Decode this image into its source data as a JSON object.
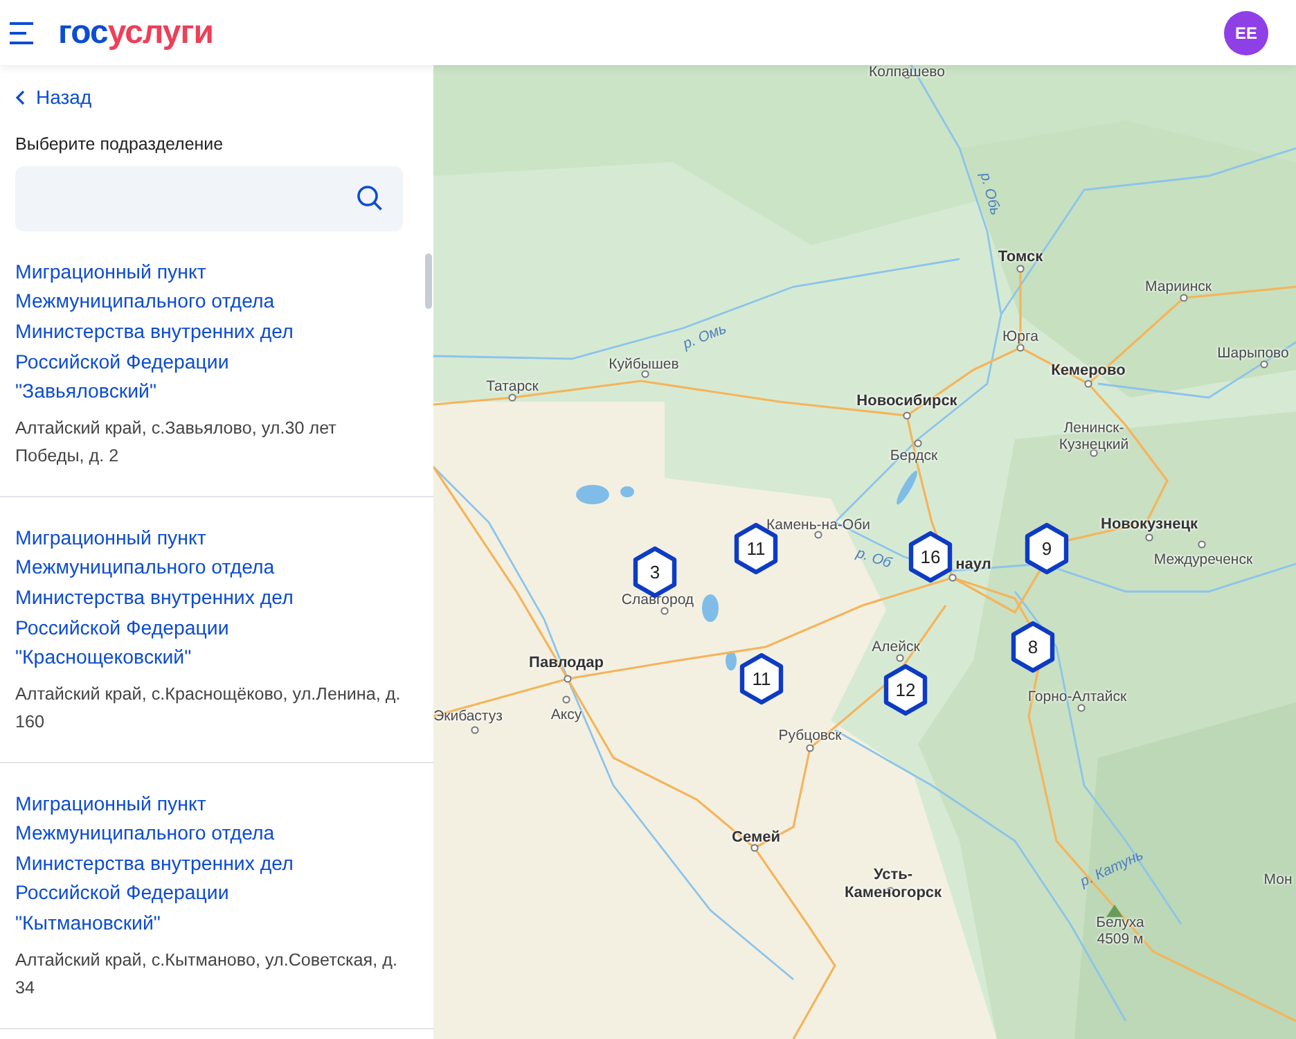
{
  "header": {
    "logo": {
      "first": "гос",
      "second": "услуги"
    },
    "avatar": "ЕЕ"
  },
  "sidebar": {
    "back": "Назад",
    "search_label": "Выберите подразделение",
    "items": [
      {
        "title": "Миграционный пункт Межмуниципального отдела Министерства внутренних дел Российской Федерации \"Завьяловский\"",
        "address": "Алтайский край, с.Завьялово, ул.30 лет Победы, д. 2"
      },
      {
        "title": "Миграционный пункт Межмуниципального отдела Министерства внутренних дел Российской Федерации \"Краснощековский\"",
        "address": "Алтайский край, с.Краснощёково, ул.Ленина, д. 160"
      },
      {
        "title": "Миграционный пункт Межмуниципального отдела Министерства внутренних дел Российской Федерации \"Кытмановский\"",
        "address": "Алтайский край, с.Кытманово, ул.Советская, д. 34"
      }
    ]
  },
  "map": {
    "labels": [
      {
        "text": "Колпашево",
        "kind": "city"
      },
      {
        "text": "р. Обь",
        "kind": "river"
      },
      {
        "text": "р. Омь",
        "kind": "river"
      },
      {
        "text": "Томск",
        "kind": "major"
      },
      {
        "text": "Мариинск",
        "kind": "city"
      },
      {
        "text": "Юрга",
        "kind": "city"
      },
      {
        "text": "Кемерово",
        "kind": "major"
      },
      {
        "text": "Шарыпово",
        "kind": "city"
      },
      {
        "text": "Куйбышев",
        "kind": "city"
      },
      {
        "text": "Татарск",
        "kind": "city"
      },
      {
        "text": "Новосибирск",
        "kind": "major"
      },
      {
        "text": "Бердск",
        "kind": "city"
      },
      {
        "text": "Ленинск-Кузнецкий",
        "kind": "city"
      },
      {
        "text": "Камень-на-Оби",
        "kind": "city"
      },
      {
        "text": "Новокузнецк",
        "kind": "major"
      },
      {
        "text": "Междуреченск",
        "kind": "city"
      },
      {
        "text": "р. Об",
        "kind": "river"
      },
      {
        "text": "наул",
        "kind": "major"
      },
      {
        "text": "Славгород",
        "kind": "city"
      },
      {
        "text": "Алейск",
        "kind": "city"
      },
      {
        "text": "Павлодар",
        "kind": "major"
      },
      {
        "text": "Экибастуз",
        "kind": "city"
      },
      {
        "text": "Аксу",
        "kind": "city"
      },
      {
        "text": "Рубцовск",
        "kind": "city"
      },
      {
        "text": "Горно-Алтайск",
        "kind": "city"
      },
      {
        "text": "Семей",
        "kind": "major"
      },
      {
        "text": "Усть-Каменогорск",
        "kind": "major"
      },
      {
        "text": "р. Катунь",
        "kind": "river"
      },
      {
        "text": "Белуха 4509 м",
        "kind": "peak"
      },
      {
        "text": "Мон",
        "kind": "city"
      }
    ],
    "markers": [
      {
        "count": "3"
      },
      {
        "count": "11"
      },
      {
        "count": "16"
      },
      {
        "count": "9"
      },
      {
        "count": "8"
      },
      {
        "count": "11"
      },
      {
        "count": "12"
      }
    ]
  }
}
